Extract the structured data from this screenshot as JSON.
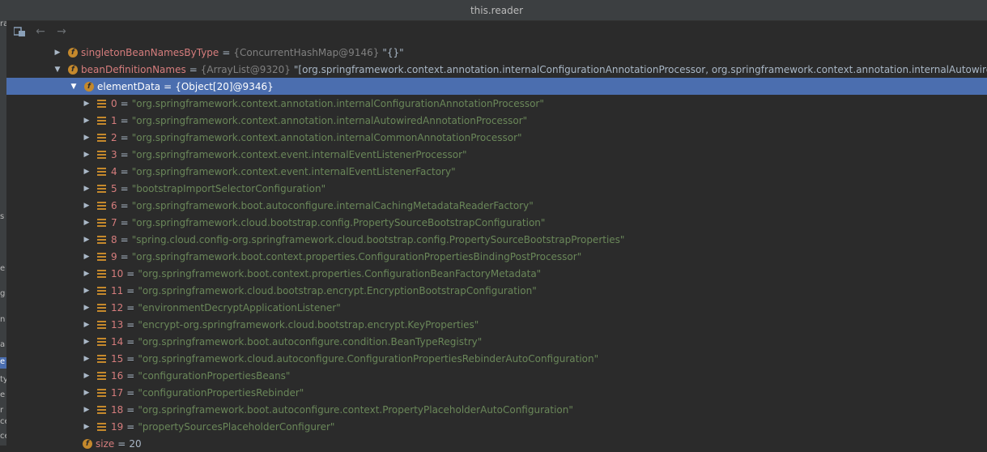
{
  "window": {
    "title": "this.reader"
  },
  "gutter": [
    "ra",
    "s",
    "e",
    "g",
    "n",
    "a",
    "e",
    "ty",
    "e",
    "r",
    "ce",
    "ce"
  ],
  "toolbar": {
    "layout_icon": "watch-layout-icon",
    "back_icon": "arrow-left-icon",
    "forward_icon": "arrow-right-icon"
  },
  "colors": {
    "background": "#2b2b2b",
    "selection": "#4b6eaf",
    "field_name": "#d67d7d",
    "string_value": "#6a8759",
    "type_text": "#808080",
    "field_icon": "#c5892c"
  },
  "tree": {
    "singleton": {
      "name": "singletonBeanNamesByType",
      "type": "{ConcurrentHashMap@9146}",
      "value": "\"{}\""
    },
    "beanDefinitionNames": {
      "name": "beanDefinitionNames",
      "type": "{ArrayList@9320}",
      "value": "\"[org.springframework.context.annotation.internalConfigurationAnnotationProcessor, org.springframework.context.annotation.internalAutowiredAnnota"
    },
    "elementData": {
      "name": "elementData",
      "type": "{Object[20]@9346}"
    },
    "items": [
      {
        "index": "0",
        "value": "\"org.springframework.context.annotation.internalConfigurationAnnotationProcessor\""
      },
      {
        "index": "1",
        "value": "\"org.springframework.context.annotation.internalAutowiredAnnotationProcessor\""
      },
      {
        "index": "2",
        "value": "\"org.springframework.context.annotation.internalCommonAnnotationProcessor\""
      },
      {
        "index": "3",
        "value": "\"org.springframework.context.event.internalEventListenerProcessor\""
      },
      {
        "index": "4",
        "value": "\"org.springframework.context.event.internalEventListenerFactory\""
      },
      {
        "index": "5",
        "value": "\"bootstrapImportSelectorConfiguration\""
      },
      {
        "index": "6",
        "value": "\"org.springframework.boot.autoconfigure.internalCachingMetadataReaderFactory\""
      },
      {
        "index": "7",
        "value": "\"org.springframework.cloud.bootstrap.config.PropertySourceBootstrapConfiguration\""
      },
      {
        "index": "8",
        "value": "\"spring.cloud.config-org.springframework.cloud.bootstrap.config.PropertySourceBootstrapProperties\""
      },
      {
        "index": "9",
        "value": "\"org.springframework.boot.context.properties.ConfigurationPropertiesBindingPostProcessor\""
      },
      {
        "index": "10",
        "value": "\"org.springframework.boot.context.properties.ConfigurationBeanFactoryMetadata\""
      },
      {
        "index": "11",
        "value": "\"org.springframework.cloud.bootstrap.encrypt.EncryptionBootstrapConfiguration\""
      },
      {
        "index": "12",
        "value": "\"environmentDecryptApplicationListener\""
      },
      {
        "index": "13",
        "value": "\"encrypt-org.springframework.cloud.bootstrap.encrypt.KeyProperties\""
      },
      {
        "index": "14",
        "value": "\"org.springframework.boot.autoconfigure.condition.BeanTypeRegistry\""
      },
      {
        "index": "15",
        "value": "\"org.springframework.cloud.autoconfigure.ConfigurationPropertiesRebinderAutoConfiguration\""
      },
      {
        "index": "16",
        "value": "\"configurationPropertiesBeans\""
      },
      {
        "index": "17",
        "value": "\"configurationPropertiesRebinder\""
      },
      {
        "index": "18",
        "value": "\"org.springframework.boot.autoconfigure.context.PropertyPlaceholderAutoConfiguration\""
      },
      {
        "index": "19",
        "value": "\"propertySourcesPlaceholderConfigurer\""
      }
    ],
    "size": {
      "name": "size",
      "value": "20"
    }
  }
}
